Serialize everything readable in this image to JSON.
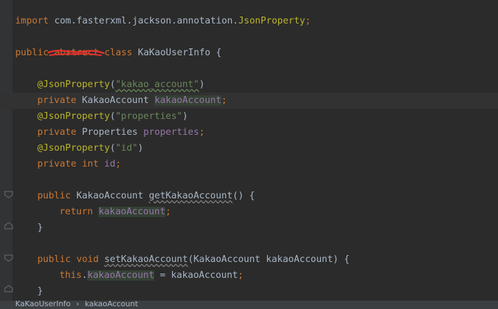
{
  "code": {
    "import_kw": "import",
    "import_path": "com.fasterxml.jackson.annotation.",
    "import_class": "JsonProperty",
    "semicolon": ";",
    "public_kw": "public",
    "abstract_kw": "abstract",
    "class_kw": "class",
    "class_name": "KaKaoUserInfo",
    "open_brace": "{",
    "close_brace": "}",
    "annotation": "@JsonProperty",
    "paren_open": "(",
    "paren_close": ")",
    "ann1_value": "\"kakao_account\"",
    "private_kw": "private",
    "type_kakao_account": "KakaoAccount",
    "field_kakao_account": "kakaoAccount",
    "ann2_value": "\"properties\"",
    "type_properties": "Properties",
    "field_properties": "properties",
    "ann3_value": "\"id\"",
    "int_kw": "int",
    "field_id": "id",
    "getter_name": "getKakaoAccount",
    "empty_params": "()",
    "return_kw": "return",
    "void_kw": "void",
    "setter_name": "setKakaoAccount",
    "setter_param": "KakaoAccount kakaoAccount",
    "this_kw": "this",
    "dot": ".",
    "assign": " = ",
    "param_name": "kakaoAccount"
  },
  "breadcrumb": {
    "class_name": "KaKaoUserInfo",
    "separator": "›",
    "field_name": "kakaoAccount"
  },
  "colors": {
    "background": "#2b2b2b",
    "keyword": "#cc7832",
    "annotation": "#bbb529",
    "string": "#6a8759",
    "field": "#9876aa",
    "plain": "#a9b7c6"
  }
}
